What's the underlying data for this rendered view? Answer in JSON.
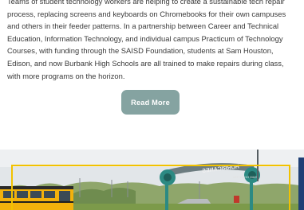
{
  "article": {
    "lines": [
      "Teams of student technology workers are helping to create a sustainable tech repair",
      "process, replacing screens and keyboards on Chromebooks for their own campuses",
      "and others in their feeder patterns. In a partnership between Career and Technical",
      "Education, Information Technology, and individual campus Practicum of Technology",
      "Courses, with funding through the SAISD Foundation, students at Sam Houston,",
      "Edison, and now Burbank High Schools are all trained to make repairs during class,",
      "with more programs on the horizon."
    ]
  },
  "read_more": {
    "label": "Read More"
  },
  "photo": {
    "sign_text": "HURRICANES",
    "sign_subtext": "SAM HOUSTON",
    "colors": {
      "frame_border": "#f2c200",
      "sign_teal": "#2c8a83",
      "bus_yellow": "#f2b10c",
      "sky": "#e2e6e9",
      "trees": "#7f9a5e"
    }
  }
}
